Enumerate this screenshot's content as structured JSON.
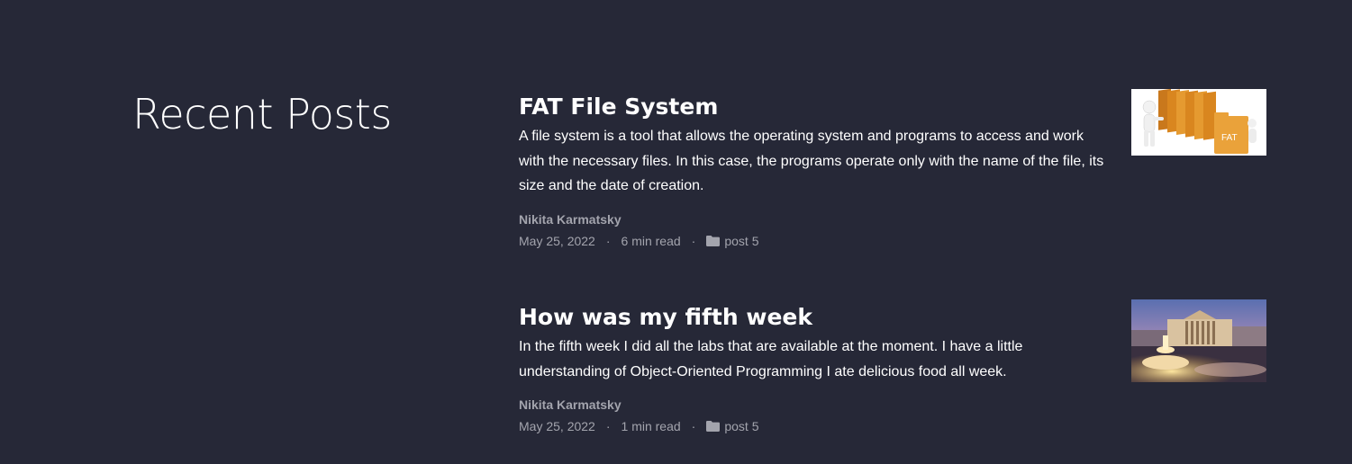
{
  "section": {
    "title": "Recent Posts"
  },
  "posts": [
    {
      "title": "FAT File System",
      "excerpt": "A file system is a tool that allows the operating system and programs to access and work with the necessary files. In this case, the programs operate only with the name of the file, its size and the date of creation.",
      "author": "Nikita Karmatsky",
      "date": "May 25, 2022",
      "read_time": "6 min read",
      "category": "post 5",
      "thumbnail_text": "FAT"
    },
    {
      "title": "How was my fifth week",
      "excerpt": "In the fifth week I did all the labs that are available at the moment. I have a little understanding of Object-Oriented Programming I ate delicious food all week.",
      "author": "Nikita Karmatsky",
      "date": "May 25, 2022",
      "read_time": "1 min read",
      "category": "post 5"
    }
  ],
  "meta": {
    "separator": "·",
    "category_icon": "folder-icon"
  },
  "colors": {
    "background": "#262837",
    "text": "#ffffff",
    "muted": "#a3a4ad"
  }
}
